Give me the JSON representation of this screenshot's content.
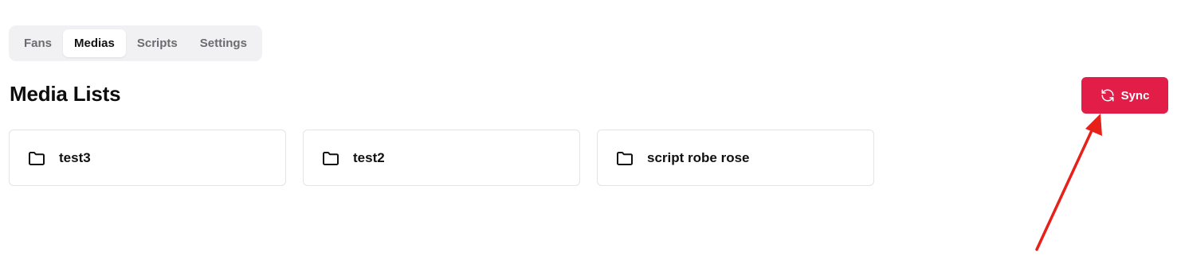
{
  "tabs": [
    {
      "label": "Fans",
      "active": false
    },
    {
      "label": "Medias",
      "active": true
    },
    {
      "label": "Scripts",
      "active": false
    },
    {
      "label": "Settings",
      "active": false
    }
  ],
  "page_title": "Media Lists",
  "sync_button": {
    "label": "Sync",
    "icon": "refresh-icon",
    "color": "#e11d48"
  },
  "media_lists": [
    {
      "name": "test3",
      "icon": "folder-icon"
    },
    {
      "name": "test2",
      "icon": "folder-icon"
    },
    {
      "name": "script robe rose",
      "icon": "folder-icon"
    }
  ],
  "annotation": {
    "type": "arrow",
    "color": "#e8201a",
    "points_to": "sync-button"
  }
}
